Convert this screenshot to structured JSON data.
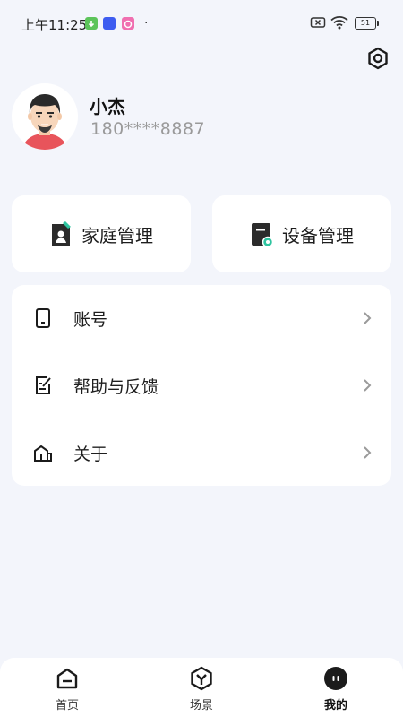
{
  "status_bar": {
    "time": "上午11:25",
    "battery": "51",
    "icons": [
      "download-icon",
      "app-icon",
      "app-icon",
      "no-sim-icon",
      "wifi-icon",
      "battery-icon"
    ]
  },
  "header": {
    "settings_icon": "settings-icon"
  },
  "profile": {
    "name": "小杰",
    "phone": "180****8887"
  },
  "cards": [
    {
      "label": "家庭管理",
      "icon": "home-card-icon"
    },
    {
      "label": "设备管理",
      "icon": "device-card-icon"
    }
  ],
  "menu": [
    {
      "label": "账号",
      "icon": "account-icon"
    },
    {
      "label": "帮助与反馈",
      "icon": "feedback-icon"
    },
    {
      "label": "关于",
      "icon": "about-icon"
    }
  ],
  "tabs": [
    {
      "label": "首页",
      "icon": "home-icon",
      "active": false
    },
    {
      "label": "场景",
      "icon": "scene-icon",
      "active": false
    },
    {
      "label": "我的",
      "icon": "profile-icon",
      "active": true
    }
  ],
  "colors": {
    "background": "#f3f5fb",
    "accent": "#2ec4a0",
    "text": "#1e1e1e",
    "muted": "#9a9a9a"
  }
}
